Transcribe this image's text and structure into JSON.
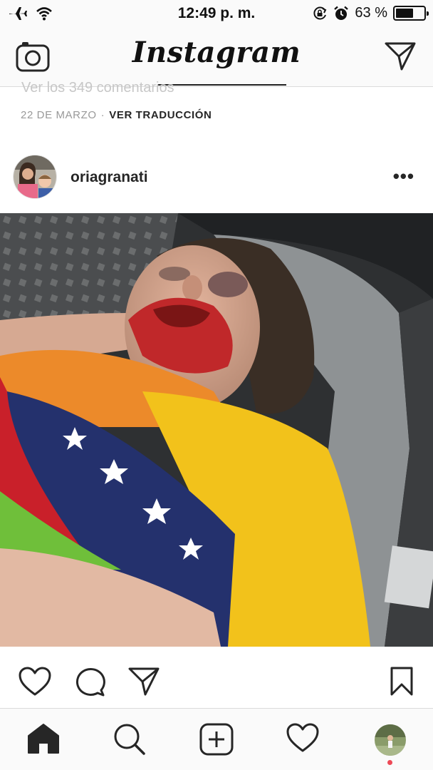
{
  "status_bar": {
    "time": "12:49 p. m.",
    "battery_text": "63 %",
    "battery_level": 0.63,
    "icons": [
      "airplane-icon",
      "wifi-icon",
      "rotation-lock-icon",
      "alarm-icon",
      "battery-icon"
    ]
  },
  "nav": {
    "logo": "Instagram",
    "icons": [
      "camera-icon",
      "direct-message-icon"
    ]
  },
  "previous_post": {
    "comments_link": "Ver los 349 comentarios",
    "date": "22 DE MARZO",
    "separator": "·",
    "translate": "VER TRADUCCIÓN"
  },
  "post": {
    "username": "oriagranati",
    "more_label": "•••",
    "photo_description_icon": "photo",
    "actions": [
      "heart-icon",
      "comment-icon",
      "share-icon",
      "bookmark-icon"
    ]
  },
  "tab_bar": {
    "tabs": [
      "home-icon",
      "search-icon",
      "add-post-icon",
      "activity-heart-icon",
      "profile-avatar"
    ],
    "active": "home",
    "notification_color": "#ed4956"
  },
  "colors": {
    "bar_bg": "#fafafa",
    "divider": "#dbdbdb",
    "text": "#262626",
    "muted": "#999999"
  }
}
